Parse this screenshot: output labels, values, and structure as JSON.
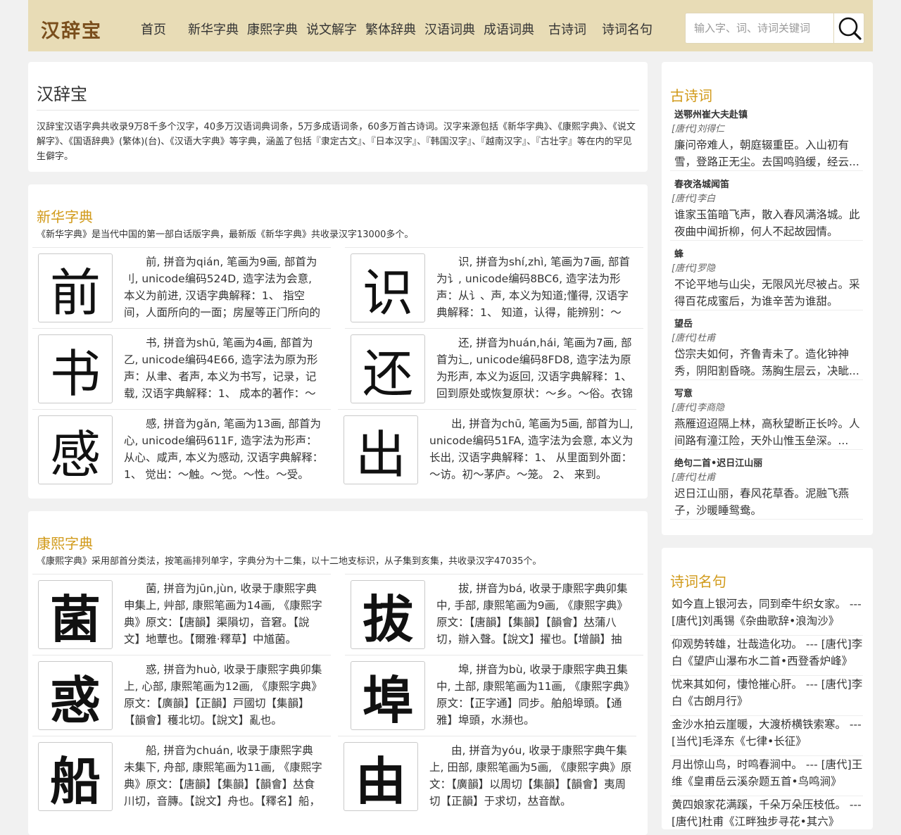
{
  "header": {
    "logo": "汉辞宝",
    "nav": [
      "首页",
      "新华字典",
      "康熙字典",
      "说文解字",
      "繁体辞典",
      "汉语词典",
      "成语词典",
      "古诗词",
      "诗词名句"
    ],
    "search_placeholder": "输入字、词、诗词关键词",
    "search_icon": "search-icon"
  },
  "intro": {
    "title": "汉辞宝",
    "text": "汉辞宝汉语字典共收录9万8千多个汉字，40多万汉语词典词条，5万多成语词条，60多万首古诗词。汉字来源包括《新华字典》、《康熙字典》、《说文解字》、《国语辞典》(繁体)(台)、《汉语大字典》等字典，涵盖了包括『隶定古文』、『日本汉字』、『韩国汉字』、『越南汉字』、『古壮字』等在内的罕见生僻字。"
  },
  "xinhua": {
    "title": "新华字典",
    "desc": "《新华字典》是当代中国的第一部白话版字典，最新版《新华字典》共收录汉字13000多个。",
    "items": [
      {
        "char": "前",
        "text": "前, 拼音为qián, 笔画为9画, 部首为刂, unicode编码524D, 造字法为会意, 本义为前进, 汉语字典解释：1、 指空间，人面所向的一面；房屋等正门所向的一面"
      },
      {
        "char": "识",
        "text": "识, 拼音为shí,zhì, 笔画为7画, 部首为讠, unicode编码8BC6, 造字法为形声：从讠、声, 本义为知道;懂得, 汉语字典解释：1、 知道，认得，能辨别：～字。"
      },
      {
        "char": "书",
        "text": "书, 拼音为shū, 笔画为4画, 部首为乙, unicode编码4E66, 造字法为原为形声：从聿、者声, 本义为书写，记录，记载, 汉语字典解释：1、 成本的著作：～籍。"
      },
      {
        "char": "还",
        "text": "还, 拼音为huán,hái, 笔画为7画, 部首为辶, unicode编码8FD8, 造字法为原为形声, 本义为返回, 汉语字典解释：1、 回到原处或恢复原状：～乡。～俗。衣锦～乡。"
      },
      {
        "char": "感",
        "text": "感, 拼音为gǎn, 笔画为13画, 部首为心, unicode编码611F, 造字法为形声：从心、咸声, 本义为感动, 汉语字典解释：1、 觉出：～触。～觉。～性。～受。"
      },
      {
        "char": "出",
        "text": "出, 拼音为chū, 笔画为5画, 部首为凵, unicode编码51FA, 造字法为会意, 本义为长出, 汉语字典解释：1、 从里面到外面：～访。初～茅庐。～笼。 2、 来到。"
      }
    ]
  },
  "kangxi": {
    "title": "康熙字典",
    "desc": "《康熙字典》采用部首分类法，按笔画排列单字，字典分为十二集，以十二地支标识，从子集到亥集，共收录汉字47035个。",
    "items": [
      {
        "char": "菌",
        "text": "菌, 拼音为jūn,jùn, 收录于康熙字典申集上, 艸部, 康熙笔画为14画, 《康熙字典》原文：【唐韻】渠隕切，音窘。【說文】地蕈也。【爾雅·釋草】中馗菌。"
      },
      {
        "char": "拔",
        "text": "拔, 拼音为bá, 收录于康熙字典卯集中, 手部, 康熙笔画为9画, 《康熙字典》原文：【唐韻】【集韻】【韻會】𠀤蒲八切，辦入聲。【說文】擢也。【增韻】抽也。"
      },
      {
        "char": "惑",
        "text": "惑, 拼音为huò, 收录于康熙字典卯集上, 心部, 康熙笔画为12画, 《康熙字典》原文：【廣韻】【正韻】戸國切【集韻】【韻會】穫北切。【說文】亂也。"
      },
      {
        "char": "埠",
        "text": "埠, 拼音为bù, 收录于康熙字典丑集中, 土部, 康熙笔画为11画, 《康熙字典》原文：【正字通】同步。舶船埠頭。【通雅】埠頭，水瀕也。"
      },
      {
        "char": "船",
        "text": "船, 拼音为chuán, 收录于康熙字典未集下, 舟部, 康熙笔画为11画, 《康熙字典》原文：【唐韻】【集韻】【韻會】𠀤食川切，音膞。【說文】舟也。【釋名】船，循也。"
      },
      {
        "char": "由",
        "text": "由, 拼音为yóu, 收录于康熙字典午集上, 田部, 康熙笔画为5画, 《康熙字典》原文：【廣韻】以周切【集韻】【韻會】夷周切【正韻】于求切，𠀤音猷。"
      }
    ]
  },
  "sidebar_poems": {
    "title": "古诗词",
    "items": [
      {
        "title": "送鄂州崔大夫赴镇",
        "author": "[唐代]刘得仁",
        "text": "廉问帝难人，朝庭辍重臣。入山初有雪，登路正无尘。去国鸣驺缓，经云..."
      },
      {
        "title": "春夜洛城闻笛",
        "author": "[唐代]李白",
        "text": "谁家玉笛暗飞声，散入春风满洛城。此夜曲中闻折柳，何人不起故园情。"
      },
      {
        "title": "蜂",
        "author": "[唐代]罗隐",
        "text": "不论平地与山尖，无限风光尽被占。采得百花成蜜后，为谁辛苦为谁甜。"
      },
      {
        "title": "望岳",
        "author": "[唐代]杜甫",
        "text": "岱宗夫如何，齐鲁青未了。造化钟神秀，阴阳割昏晓。荡胸生层云，决眦..."
      },
      {
        "title": "写意",
        "author": "[唐代]李商隐",
        "text": "燕雁迢迢隔上林，高秋望断正长吟。人间路有潼江险，天外山惟玉垒深。..."
      },
      {
        "title": "绝句二首•迟日江山丽",
        "author": "[唐代]杜甫",
        "text": "迟日江山丽，春风花草香。泥融飞燕子，沙暖睡鸳鸯。"
      }
    ]
  },
  "sidebar_quotes": {
    "title": "诗词名句",
    "items": [
      "如今直上银河去，同到牵牛织女家。 --- [唐代]刘禹锡《杂曲歌辞•浪淘沙》",
      "仰观势转雄，壮哉造化功。 --- [唐代]李白《望庐山瀑布水二首•西登香炉峰》",
      "忧来其如何，悽怆摧心肝。 --- [唐代]李白《古朗月行》",
      "金沙水拍云崖暖，大渡桥横铁索寒。 --- [当代]毛泽东《七律•长征》",
      "月出惊山鸟，时鸣春涧中。 --- [唐代]王维《皇甫岳云溪杂题五首•鸟鸣涧》",
      "黄四娘家花满蹊，千朵万朵压枝低。 --- [唐代]杜甫《江畔独步寻花•其六》"
    ]
  }
}
